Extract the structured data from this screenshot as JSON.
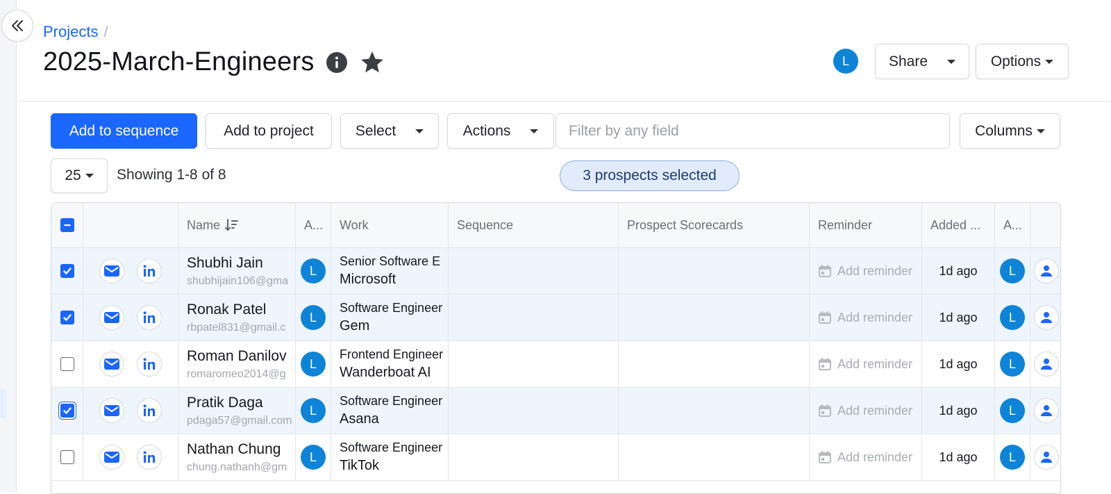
{
  "breadcrumb": {
    "root": "Projects",
    "separator": "/"
  },
  "page": {
    "title": "2025-March-Engineers",
    "info_icon": "info-icon",
    "star_icon": "star-icon"
  },
  "header": {
    "user_avatar": "L",
    "share_label": "Share",
    "options_label": "Options"
  },
  "toolbar": {
    "add_to_sequence": "Add to sequence",
    "add_to_project": "Add to project",
    "select": "Select",
    "actions": "Actions",
    "filter_placeholder": "Filter by any field",
    "columns": "Columns"
  },
  "pagination": {
    "page_size": "25",
    "showing": "Showing 1-8 of 8",
    "selected": "3 prospects selected"
  },
  "table": {
    "headers": {
      "name": "Name",
      "assignee": "A...",
      "work": "Work",
      "sequence": "Sequence",
      "scorecards": "Prospect Scorecards",
      "reminder": "Reminder",
      "added": "Added ...",
      "owner": "A..."
    },
    "rows": [
      {
        "name": "Shubhi Jain",
        "email": "shubhijain106@gma",
        "avatar": "L",
        "work_title": "Senior Software E",
        "company": "Microsoft",
        "reminder": "Add reminder",
        "added": "1d ago",
        "owner": "L",
        "checked": true
      },
      {
        "name": "Ronak Patel",
        "email": "rbpatel831@gmail.c",
        "avatar": "L",
        "work_title": "Software Engineer",
        "company": "Gem",
        "reminder": "Add reminder",
        "added": "1d ago",
        "owner": "L",
        "checked": true
      },
      {
        "name": "Roman Danilov",
        "email": "romaromeo2014@g",
        "avatar": "L",
        "work_title": "Frontend Engineer",
        "company": "Wanderboat AI",
        "reminder": "Add reminder",
        "added": "1d ago",
        "owner": "L",
        "checked": false
      },
      {
        "name": "Pratik Daga",
        "email": "pdaga57@gmail.com",
        "avatar": "L",
        "work_title": "Software Engineer",
        "company": "Asana",
        "reminder": "Add reminder",
        "added": "1d ago",
        "owner": "L",
        "checked": true
      },
      {
        "name": "Nathan Chung",
        "email": "chung.nathanh@gm",
        "avatar": "L",
        "work_title": "Software Engineer",
        "company": "TikTok",
        "reminder": "Add reminder",
        "added": "1d ago",
        "owner": "L",
        "checked": false
      }
    ]
  },
  "colors": {
    "primary": "#1a66ff",
    "avatar": "#0d84d8",
    "selected_row": "#eff5fd"
  }
}
